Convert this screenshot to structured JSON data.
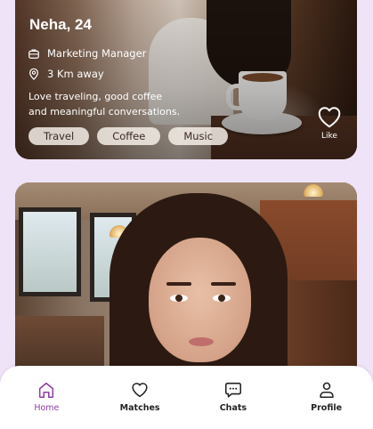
{
  "profile_card": {
    "name": "Neha, 24",
    "job": "Marketing Manager",
    "distance": "3 Km away",
    "bio_line1": "Love traveling, good coffee",
    "bio_line2": "and meaningful conversations.",
    "tags": [
      "Travel",
      "Coffee",
      "Music"
    ],
    "like_label": "Like"
  },
  "nav": {
    "items": [
      {
        "label": "Home",
        "icon": "home-icon",
        "active": true
      },
      {
        "label": "Matches",
        "icon": "heart-icon",
        "active": false
      },
      {
        "label": "Chats",
        "icon": "chat-icon",
        "active": false
      },
      {
        "label": "Profile",
        "icon": "user-icon",
        "active": false
      }
    ]
  },
  "colors": {
    "background": "#efe3f7",
    "accent": "#8b3ea8",
    "nav_bg": "#ffffff"
  }
}
